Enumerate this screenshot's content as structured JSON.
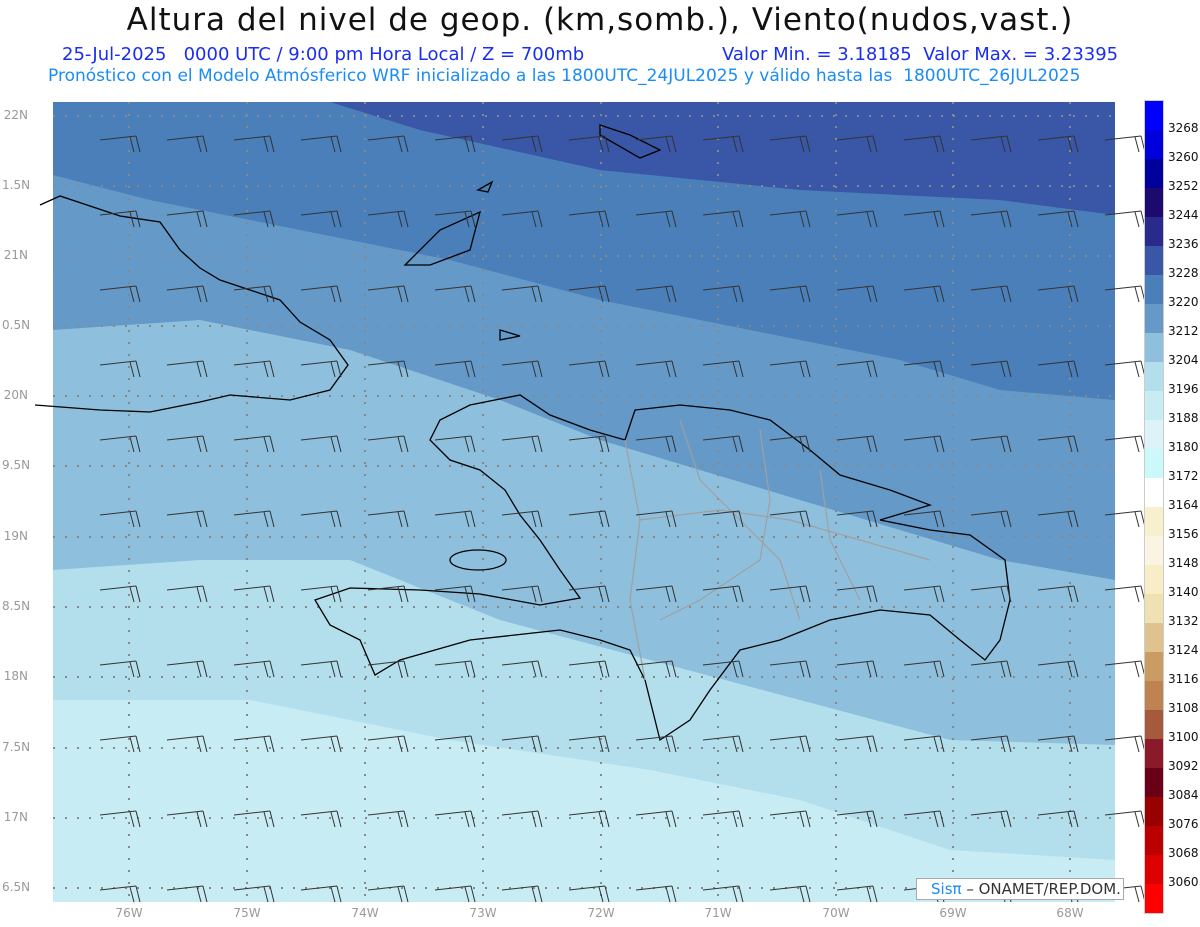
{
  "header": {
    "title": "Altura del nivel de geop. (km,somb.), Viento(nudos,vast.)",
    "datetime": "25-Jul-2025   0000 UTC / 9:00 pm Hora Local / Z = 700mb",
    "minmax": "Valor Min. = 3.18185  Valor Max. = 3.23395",
    "forecast": "Pronóstico con el Modelo Atmósferico WRF inicializado a las 1800UTC_24JUL2025 y válido hasta las  1800UTC_26JUL2025"
  },
  "lat_labels": [
    "22N",
    "1.5N",
    "21N",
    "0.5N",
    "20N",
    "9.5N",
    "19N",
    "8.5N",
    "18N",
    "7.5N",
    "17N",
    "6.5N"
  ],
  "lon_labels": [
    "76W",
    "75W",
    "74W",
    "73W",
    "72W",
    "71W",
    "70W",
    "69W",
    "68W"
  ],
  "colorbar": {
    "labels": [
      "3268",
      "3260",
      "3252",
      "3244",
      "3236",
      "3228",
      "3220",
      "3212",
      "3204",
      "3196",
      "3188",
      "3180",
      "3172",
      "3164",
      "3156",
      "3148",
      "3140",
      "3132",
      "3124",
      "3116",
      "3108",
      "3100",
      "3092",
      "3084",
      "3076",
      "3068",
      "3060"
    ],
    "colors": [
      "#0000ff",
      "#0000dd",
      "#00009a",
      "#1c0a6e",
      "#2a2a8c",
      "#3a56a6",
      "#4a7fba",
      "#6499c8",
      "#8ec0de",
      "#b3dfed",
      "#c8ecf4",
      "#dcf3f8",
      "#cbf8fa",
      "#ffffff",
      "#f6f1cc",
      "#faf5e2",
      "#f7edc6",
      "#f0e1b5",
      "#dfc28e",
      "#c99c64",
      "#bf8352",
      "#a55a3e",
      "#8a1a2a",
      "#6a0018",
      "#990000",
      "#bb0000",
      "#dd0000",
      "#ff0000"
    ]
  },
  "shading_colors": [
    "#3a56a6",
    "#4a7fba",
    "#6499c8",
    "#8ec0de",
    "#b3dfed",
    "#c8ecf4"
  ],
  "credit": {
    "brand": "Sisπ",
    "text": " –  ONAMET/REP.DOM."
  }
}
